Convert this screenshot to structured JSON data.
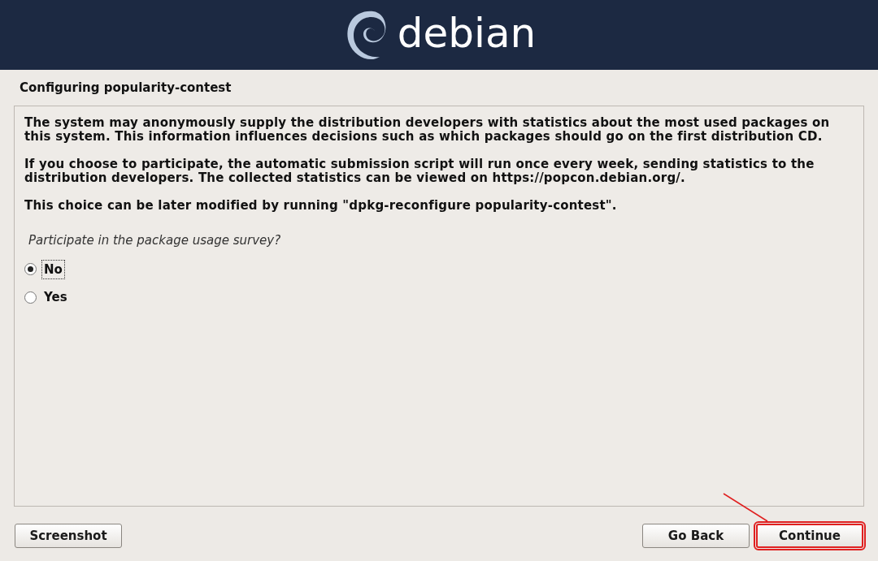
{
  "header": {
    "logo_text": "debian"
  },
  "title": "Configuring popularity-contest",
  "paragraphs": [
    "The system may anonymously supply the distribution developers with statistics about the most used packages on this system. This information influences decisions such as which packages should go on the first distribution CD.",
    "If you choose to participate, the automatic submission script will run once every week, sending statistics to the distribution developers. The collected statistics can be viewed on https://popcon.debian.org/.",
    "This choice can be later modified by running \"dpkg-reconfigure popularity-contest\"."
  ],
  "question": "Participate in the package usage survey?",
  "options": [
    {
      "label": "No",
      "selected": true
    },
    {
      "label": "Yes",
      "selected": false
    }
  ],
  "buttons": [
    {
      "label": "Screenshot",
      "highlighted": false
    },
    {
      "label": "Go Back",
      "highlighted": false
    },
    {
      "label": "Continue",
      "highlighted": true
    }
  ]
}
